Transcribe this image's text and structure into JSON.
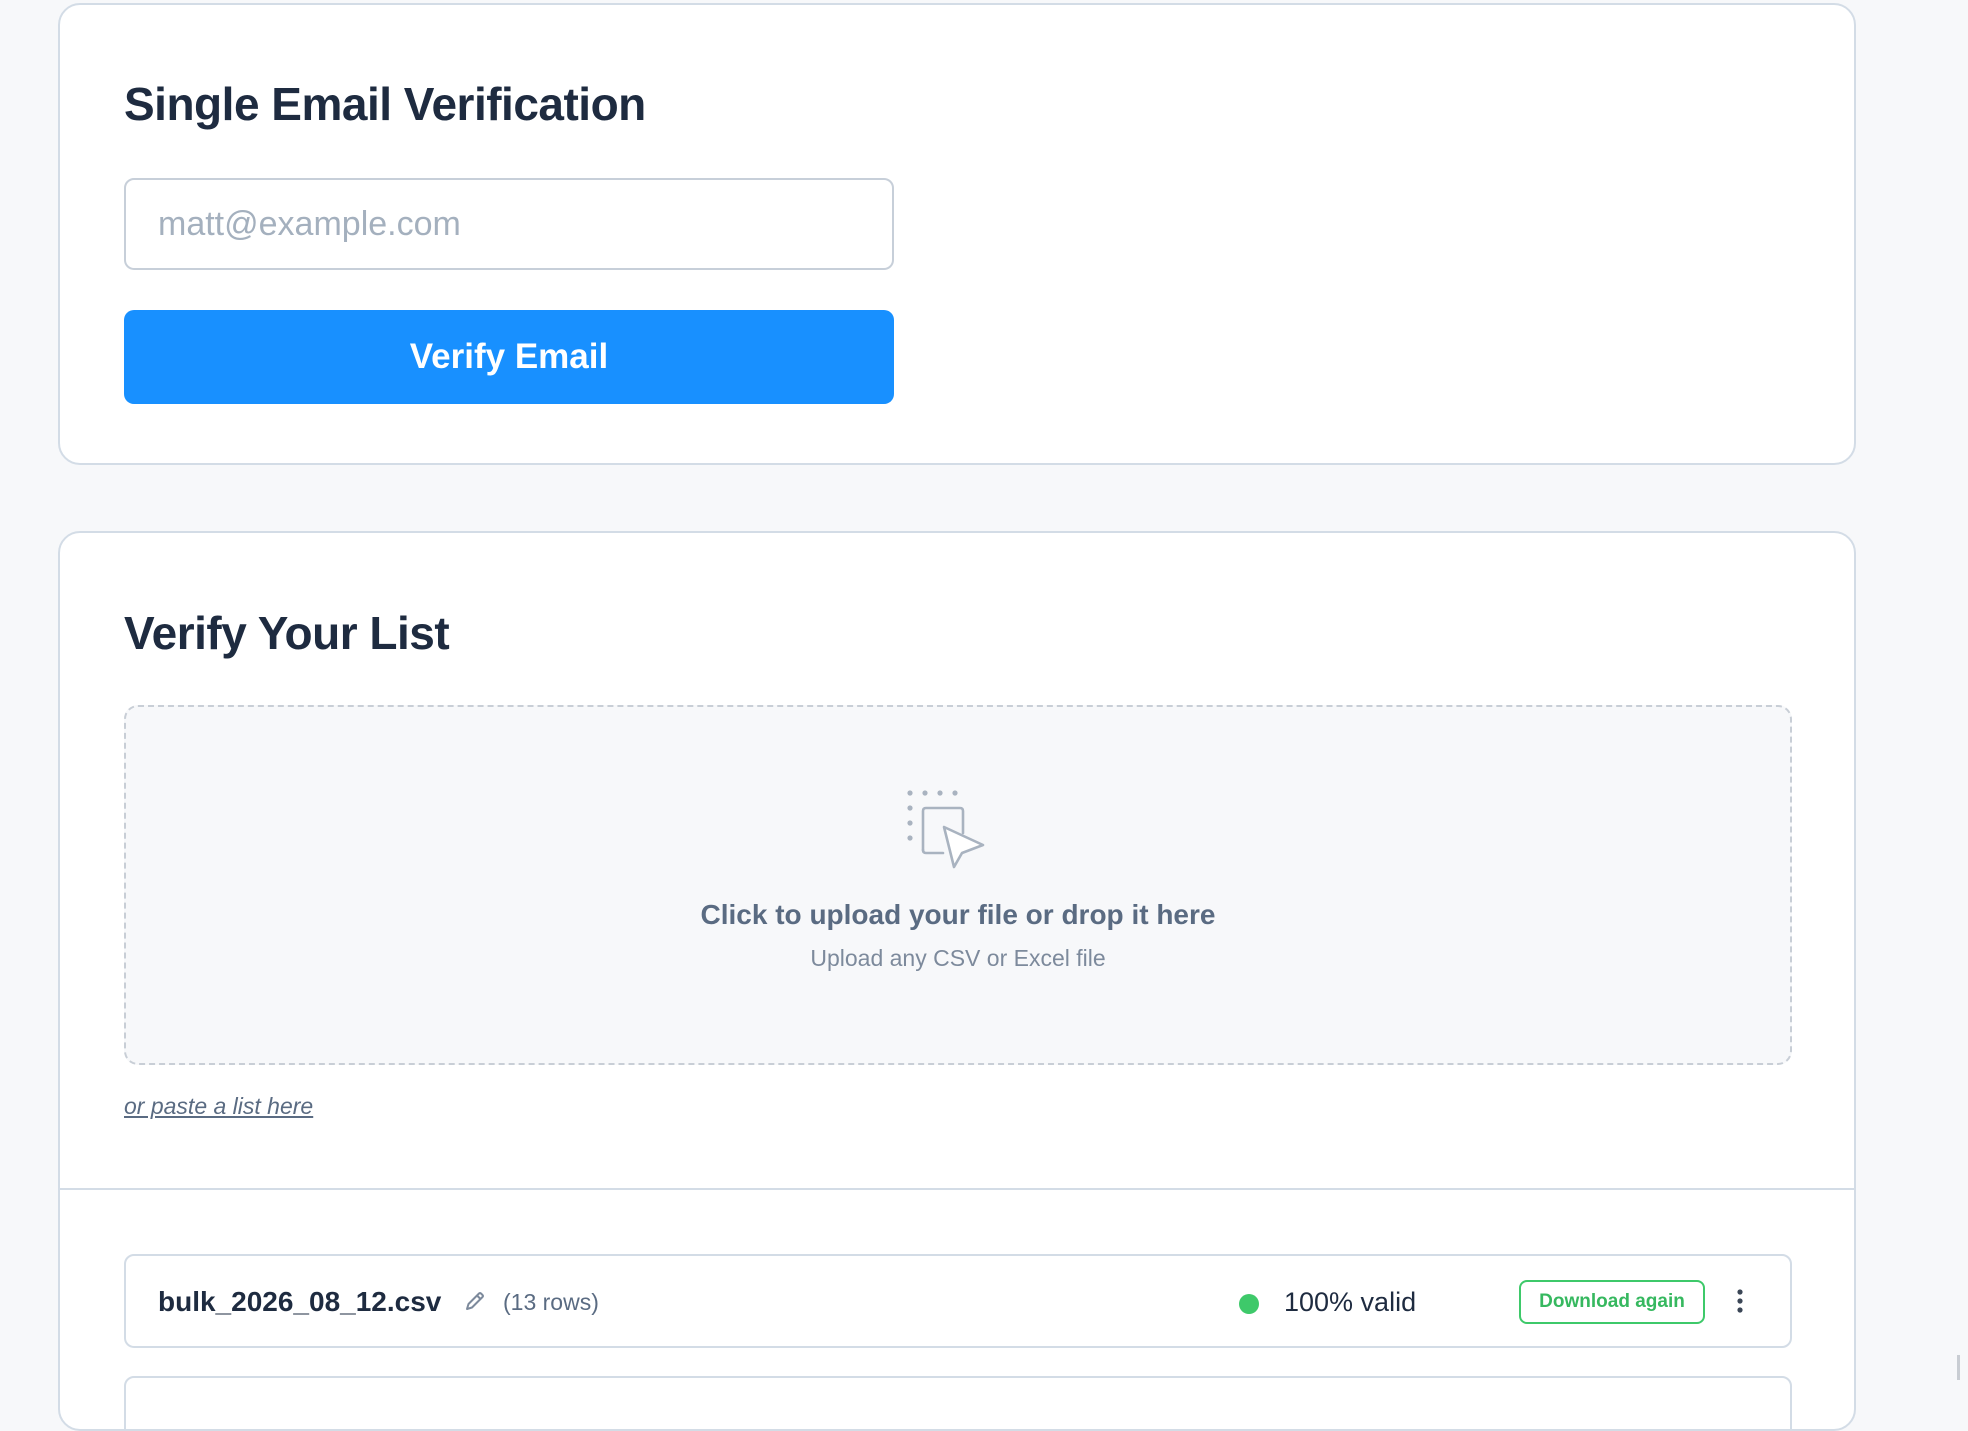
{
  "single_verification": {
    "title": "Single Email Verification",
    "email_placeholder": "matt@example.com",
    "verify_button_label": "Verify Email"
  },
  "list_verification": {
    "title": "Verify Your List",
    "dropzone": {
      "icon": "drag-drop-cursor-icon",
      "title": "Click to upload your file or drop it here",
      "subtitle": "Upload any CSV or Excel file"
    },
    "paste_link_label": "or paste a list here",
    "files": [
      {
        "name": "bulk_2026_08_12.csv",
        "rows_label": "(13 rows)",
        "valid_label": "100% valid",
        "status_color": "#3ec96a",
        "action_label": "Download again"
      }
    ]
  },
  "colors": {
    "primary": "#1890ff",
    "success": "#3ec96a",
    "heading": "#1e2b40",
    "border": "#d3dce6",
    "background": "#f7f8fa"
  }
}
